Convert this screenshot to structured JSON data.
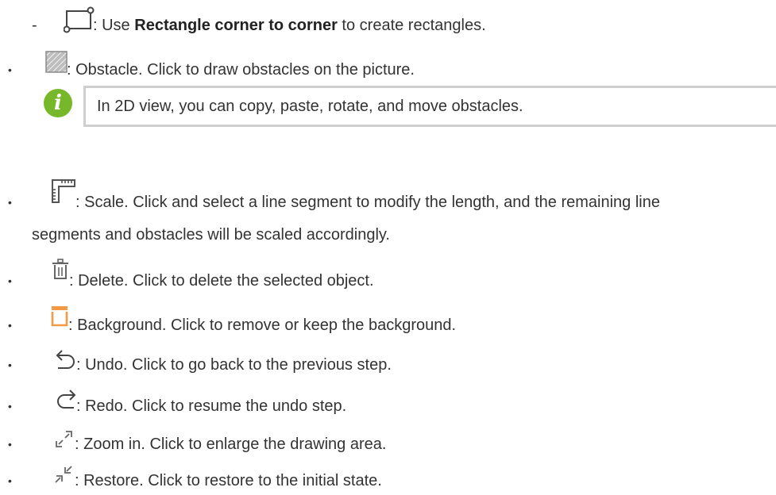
{
  "items": [
    {
      "marker": "-",
      "icon": "rectangle-corner-to-corner-icon",
      "pre": ": Use ",
      "bold": "Rectangle corner to corner",
      "post": " to create rectangles."
    },
    {
      "marker": "•",
      "icon": "obstacle-icon",
      "text": ": Obstacle. Click to draw obstacles on the picture."
    },
    {
      "marker": "•",
      "icon": "scale-icon",
      "text": ": Scale. Click and select a line segment to modify the length, and the remaining line",
      "text2": "segments and obstacles will be scaled accordingly."
    },
    {
      "marker": "•",
      "icon": "delete-icon",
      "text": " : Delete. Click to delete the selected object."
    },
    {
      "marker": "•",
      "icon": "background-icon",
      "text": ": Background. Click to remove or keep the background."
    },
    {
      "marker": "•",
      "icon": "undo-icon",
      "text": ": Undo. Click to go back to the previous step."
    },
    {
      "marker": "•",
      "icon": "redo-icon",
      "text": ": Redo. Click to resume the undo step."
    },
    {
      "marker": "•",
      "icon": "zoom-in-icon",
      "text": ": Zoom in. Click to enlarge the drawing area."
    },
    {
      "marker": "•",
      "icon": "restore-icon",
      "text": ": Restore. Click to restore to the initial state."
    }
  ],
  "note": {
    "icon": "info-icon",
    "glyph": "i",
    "text": "In 2D view, you can copy, paste, rotate, and move obstacles."
  },
  "colors": {
    "text": "#333333",
    "info_green": "#76b82a",
    "background_icon_orange": "#f39a47",
    "note_border": "#cfcfcf"
  }
}
